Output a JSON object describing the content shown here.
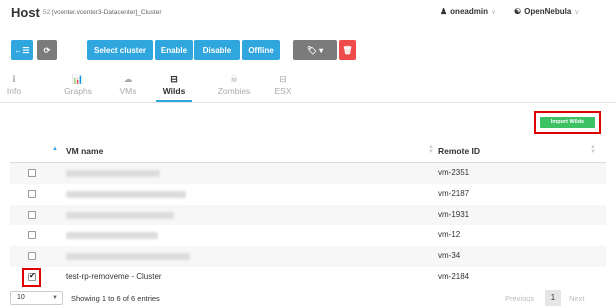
{
  "header": {
    "title": "Host",
    "id": "52",
    "name": "[vcenter.vcenter3-Datacenter]_Cluster",
    "user": "oneadmin",
    "zone": "OpenNebula"
  },
  "toolbar": {
    "back_icon": "←☰",
    "refresh_icon": "⟳",
    "select_cluster": "Select cluster",
    "enable": "Enable",
    "disable": "Disable",
    "offline": "Offline",
    "labels_icon": "🏷 ▾",
    "delete_icon": "🗑",
    "accent": "#2fa6dd",
    "danger": "#ef4b4b"
  },
  "tabs": [
    {
      "icon": "ℹ",
      "label": "Info"
    },
    {
      "icon": "📊",
      "label": "Graphs"
    },
    {
      "icon": "☁",
      "label": "VMs"
    },
    {
      "icon": "⊟",
      "label": "Wilds"
    },
    {
      "icon": "☠",
      "label": "Zombies"
    },
    {
      "icon": "⊟",
      "label": "ESX"
    }
  ],
  "import_wilds": "Import Wilds",
  "table": {
    "col_vm": "VM name",
    "col_remote": "Remote ID",
    "rows": [
      {
        "name": "",
        "remote": "vm-2351",
        "checked": false
      },
      {
        "name": "",
        "remote": "vm-2187",
        "checked": false
      },
      {
        "name": "",
        "remote": "vm-1931",
        "checked": false
      },
      {
        "name": "",
        "remote": "vm-12",
        "checked": false
      },
      {
        "name": "",
        "remote": "vm-34",
        "checked": false
      },
      {
        "name": "test-rp-removeme - Cluster",
        "remote": "vm-2184",
        "checked": true
      }
    ]
  },
  "footer": {
    "page_length": "10",
    "showing": "Showing 1 to 6 of 6 entries",
    "previous": "Previous",
    "current_page": "1",
    "next": "Next"
  }
}
